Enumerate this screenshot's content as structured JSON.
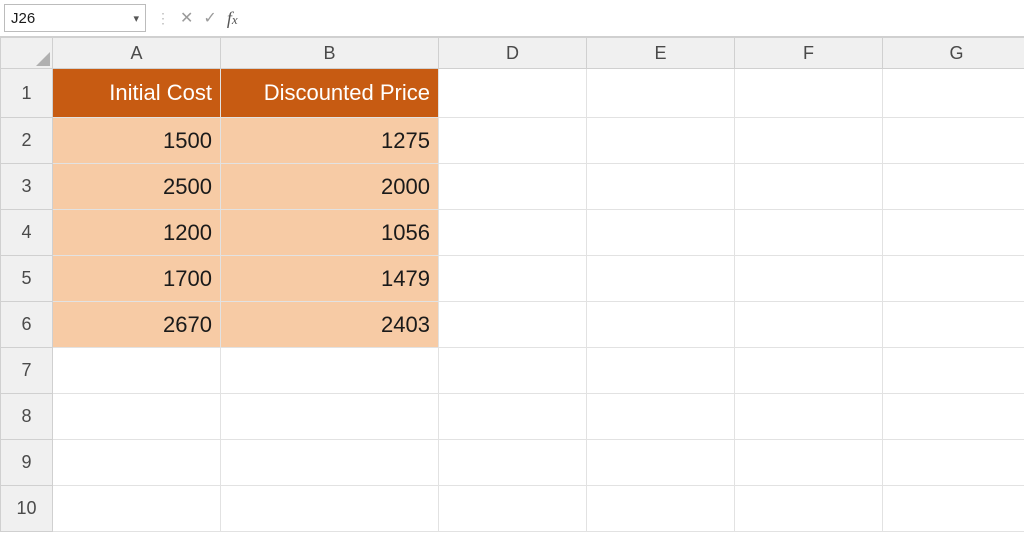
{
  "namebox": {
    "value": "J26"
  },
  "formula_bar": {
    "value": ""
  },
  "columns": [
    "A",
    "B",
    "D",
    "E",
    "F",
    "G"
  ],
  "row_numbers": [
    1,
    2,
    3,
    4,
    5,
    6,
    7,
    8,
    9,
    10
  ],
  "table": {
    "headers": {
      "A": "Initial Cost",
      "B": "Discounted Price"
    },
    "rows": [
      {
        "A": "1500",
        "B": "1275"
      },
      {
        "A": "2500",
        "B": "2000"
      },
      {
        "A": "1200",
        "B": "1056"
      },
      {
        "A": "1700",
        "B": "1479"
      },
      {
        "A": "2670",
        "B": "2403"
      }
    ]
  }
}
